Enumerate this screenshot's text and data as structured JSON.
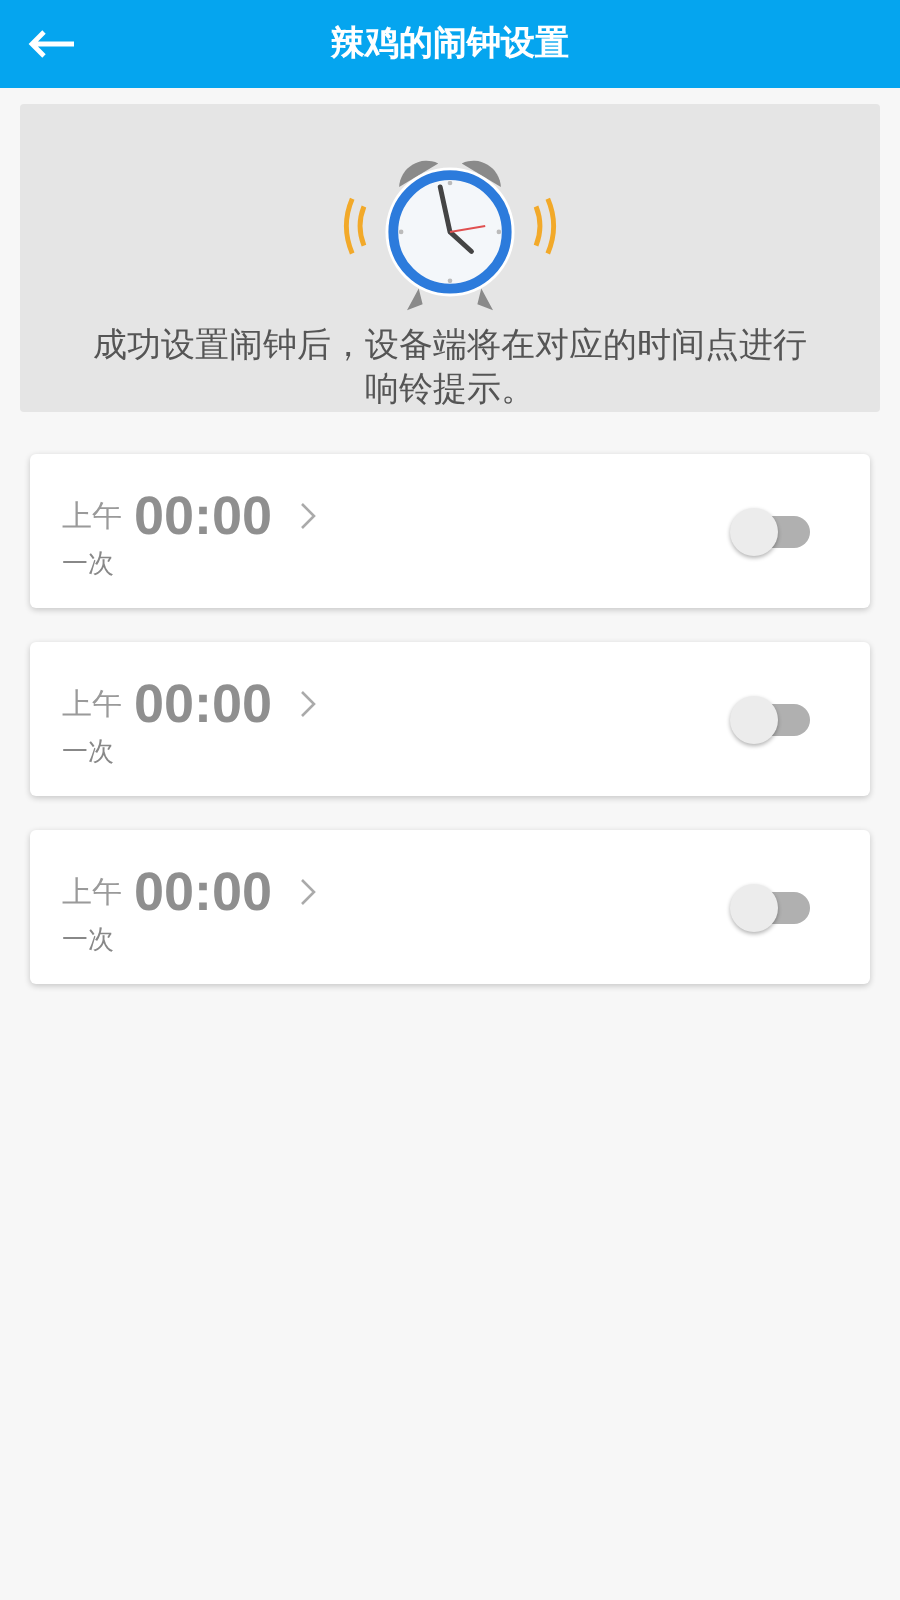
{
  "header": {
    "title": "辣鸡的闹钟设置"
  },
  "banner": {
    "message": "成功设置闹钟后，设备端将在对应的时间点进行响铃提示。"
  },
  "alarms": [
    {
      "period": "上午",
      "time": "00:00",
      "repeat": "一次",
      "on": false
    },
    {
      "period": "上午",
      "time": "00:00",
      "repeat": "一次",
      "on": false
    },
    {
      "period": "上午",
      "time": "00:00",
      "repeat": "一次",
      "on": false
    }
  ]
}
